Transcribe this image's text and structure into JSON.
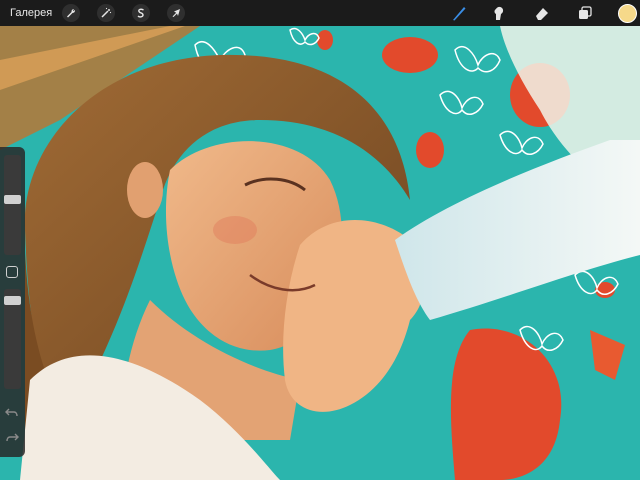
{
  "toolbar": {
    "gallery_label": "Галерея",
    "actions_icon": "wrench-icon",
    "adjustments_icon": "magic-wand-icon",
    "selection_icon": "selection-s-icon",
    "transform_icon": "arrow-cursor-icon",
    "brush_icon": "brush-icon",
    "smudge_icon": "smudge-finger-icon",
    "eraser_icon": "eraser-icon",
    "layers_icon": "layers-icon",
    "active_tool": "brush",
    "current_color": "#f6d98a"
  },
  "sidebar": {
    "brush_size": 0.56,
    "opacity": 0.92,
    "undo_icon": "undo-arrow-icon",
    "redo_icon": "redo-arrow-icon"
  },
  "canvas": {
    "description_icon": "artwork-canvas"
  },
  "colors": {
    "toolbar_bg": "#1b1b1b",
    "accent_blue": "#3a8ee6",
    "teal": "#2bb5ad",
    "red": "#e24a2c",
    "skin": "#e9a878",
    "hair": "#8b5a2b"
  }
}
